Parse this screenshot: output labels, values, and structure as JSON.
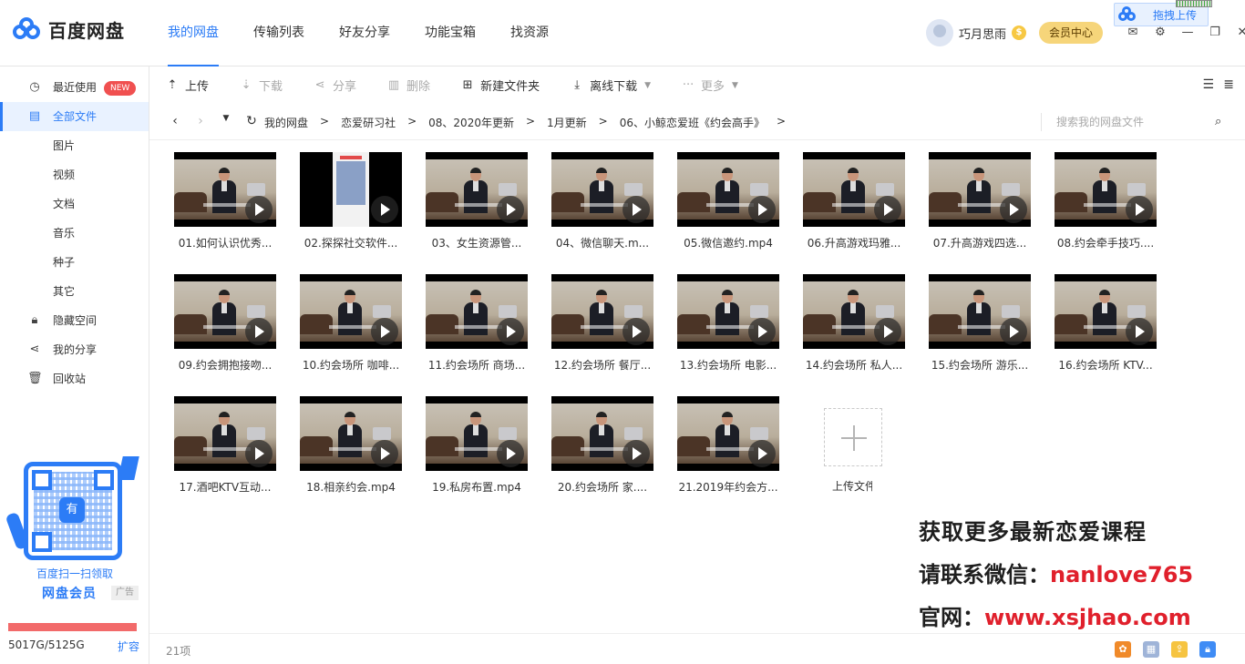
{
  "app": {
    "logo_text": "百度网盘"
  },
  "nav": [
    "我的网盘",
    "传输列表",
    "好友分享",
    "功能宝箱",
    "找资源"
  ],
  "user": {
    "name": "巧月思雨",
    "vip_badge": "$",
    "vip_center": "会员中心"
  },
  "drag_upload": "拖拽上传",
  "sidebar": {
    "items": [
      {
        "label": "最近使用",
        "icon": "clock-icon",
        "badge": "NEW"
      },
      {
        "label": "全部文件",
        "icon": "document-icon"
      },
      {
        "label": "图片"
      },
      {
        "label": "视频"
      },
      {
        "label": "文档"
      },
      {
        "label": "音乐"
      },
      {
        "label": "种子"
      },
      {
        "label": "其它"
      },
      {
        "label": "隐藏空间",
        "icon": "lock-icon"
      },
      {
        "label": "我的分享",
        "icon": "share-icon"
      },
      {
        "label": "回收站",
        "icon": "trash-icon"
      }
    ],
    "qr_line1": "百度扫一扫领取",
    "qr_line2": "网盘会员",
    "qr_center": "有",
    "ad_tag": "广告",
    "quota": "5017G/5125G",
    "quota_used_fraction": 0.979,
    "expand": "扩容"
  },
  "toolbar": {
    "upload": "上传",
    "download": "下载",
    "share": "分享",
    "delete": "删除",
    "new_folder": "新建文件夹",
    "offline": "离线下载",
    "more": "更多"
  },
  "breadcrumb": [
    "我的网盘",
    "恋爱研习社",
    "08、2020年更新",
    "1月更新",
    "06、小鲸恋爱班《约会高手》"
  ],
  "search": {
    "placeholder": "搜索我的网盘文件"
  },
  "files": [
    "01.如何认识优秀...",
    "02.探探社交软件...",
    "03、女生资源管...",
    "04、微信聊天.m...",
    "05.微信邀约.mp4",
    "06.升高游戏玛雅...",
    "07.升高游戏四选...",
    "08.约会牵手技巧....",
    "09.约会拥抱接吻...",
    "10.约会场所 咖啡...",
    "11.约会场所 商场...",
    "12.约会场所 餐厅...",
    "13.约会场所 电影...",
    "14.约会场所 私人...",
    "15.约会场所 游乐...",
    "16.约会场所 KTV...",
    "17.酒吧KTV互动...",
    "18.相亲约会.mp4",
    "19.私房布置.mp4",
    "20.约会场所 家....",
    "21.2019年约会方..."
  ],
  "upload_tile_label": "上传文件",
  "promo": {
    "line1": "获取更多最新恋爱课程",
    "line2_prefix": "请联系微信：",
    "line2_value": "nanlove765",
    "line3_prefix": "官网：",
    "line3_value": "www.xsjhao.com"
  },
  "status": {
    "count": "21项"
  }
}
